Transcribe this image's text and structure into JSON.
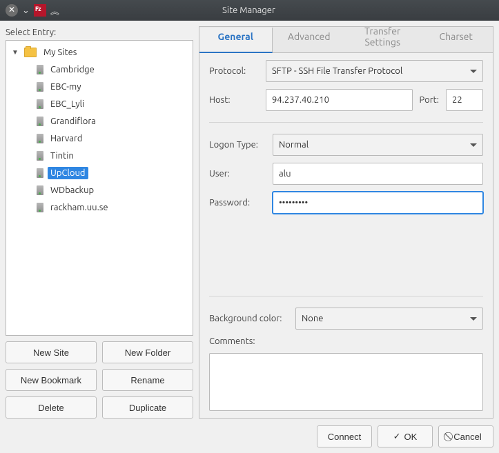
{
  "titlebar": {
    "title": "Site Manager"
  },
  "left": {
    "select_entry_label": "Select Entry:",
    "root_label": "My Sites",
    "sites": [
      "Cambridge",
      "EBC-my",
      "EBC_Lyli",
      "Grandiflora",
      "Harvard",
      "Tintin",
      "UpCloud",
      "WDbackup",
      "rackham.uu.se"
    ],
    "selected_index": 6,
    "buttons": {
      "new_site": "New Site",
      "new_folder": "New Folder",
      "new_bookmark": "New Bookmark",
      "rename": "Rename",
      "delete": "Delete",
      "duplicate": "Duplicate"
    }
  },
  "tabs": [
    "General",
    "Advanced",
    "Transfer Settings",
    "Charset"
  ],
  "active_tab": 0,
  "form": {
    "protocol_label": "Protocol:",
    "protocol_value": "SFTP - SSH File Transfer Protocol",
    "host_label": "Host:",
    "host_value": "94.237.40.210",
    "port_label": "Port:",
    "port_value": "22",
    "logon_type_label": "Logon Type:",
    "logon_type_value": "Normal",
    "user_label": "User:",
    "user_value": "alu",
    "password_label": "Password:",
    "password_value": "•••••••••",
    "background_color_label": "Background color:",
    "background_color_value": "None",
    "comments_label": "Comments:",
    "comments_value": ""
  },
  "footer": {
    "connect": "Connect",
    "ok": "OK",
    "cancel": "Cancel"
  }
}
